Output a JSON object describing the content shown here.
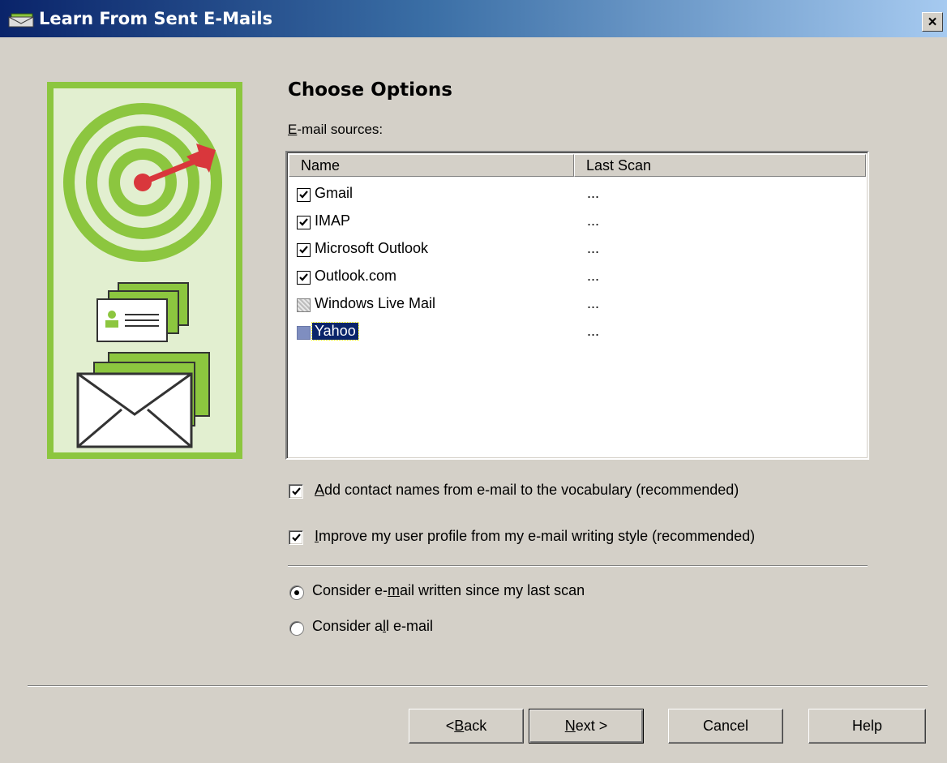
{
  "window": {
    "title": "Learn From Sent E-Mails",
    "close_label": "×"
  },
  "heading": "Choose Options",
  "sources": {
    "label_prefix": "E",
    "label_rest": "-mail sources:",
    "columns": [
      "Name",
      "Last Scan"
    ],
    "rows": [
      {
        "name": "Gmail",
        "last_scan": "...",
        "state": "checked"
      },
      {
        "name": "IMAP",
        "last_scan": "...",
        "state": "checked"
      },
      {
        "name": "Microsoft Outlook",
        "last_scan": "...",
        "state": "checked"
      },
      {
        "name": "Outlook.com",
        "last_scan": "...",
        "state": "checked"
      },
      {
        "name": "Windows Live Mail",
        "last_scan": "...",
        "state": "disabled"
      },
      {
        "name": "Yahoo",
        "last_scan": "...",
        "state": "selected"
      }
    ]
  },
  "options": {
    "add_contacts": {
      "key": "A",
      "rest": "dd contact names from e-mail to the vocabulary (recommended)",
      "checked": true
    },
    "improve_profile": {
      "key": "I",
      "rest": "mprove my user profile from my e-mail writing style (recommended)",
      "checked": true
    }
  },
  "scan_scope": {
    "since_last": {
      "pre": "Consider e-",
      "key": "m",
      "post": "ail written since my last scan",
      "selected": true
    },
    "all": {
      "pre": "Consider a",
      "key": "l",
      "post": "l e-mail",
      "selected": false
    }
  },
  "buttons": {
    "back": {
      "pre": "< ",
      "key": "B",
      "post": "ack"
    },
    "next": {
      "pre": "",
      "key": "N",
      "post": "ext >"
    },
    "cancel": "Cancel",
    "help": "Help"
  },
  "colors": {
    "illustration_green": "#8cc63f",
    "illustration_light": "#e2efd0",
    "dart_red": "#d9373c"
  }
}
